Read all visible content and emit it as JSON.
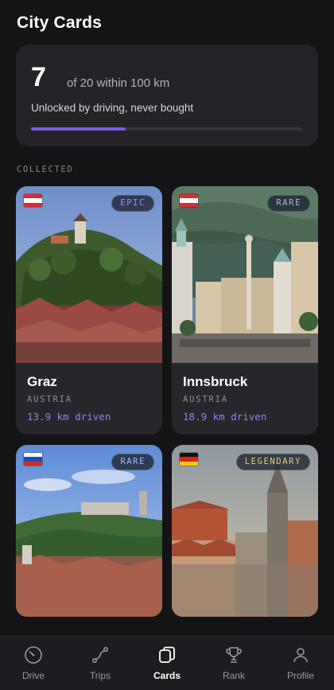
{
  "header": {
    "title": "City Cards"
  },
  "summary": {
    "count": "7",
    "of_text": "of 20 within 100 km",
    "description": "Unlocked by driving, never bought",
    "progress": 0.35
  },
  "section_label": "COLLECTED",
  "cards": [
    {
      "city": "Graz",
      "country": "AUSTRIA",
      "distance": "13.9 km driven",
      "rarity": "EPIC",
      "flag": [
        "#d92b35",
        "#ffffff",
        "#d92b35"
      ]
    },
    {
      "city": "Innsbruck",
      "country": "AUSTRIA",
      "distance": "18.9 km driven",
      "rarity": "RARE",
      "flag": [
        "#d92b35",
        "#ffffff",
        "#d92b35"
      ]
    },
    {
      "rarity": "RARE",
      "flag": [
        "#ffffff",
        "#1f4bb8",
        "#d52b1e"
      ]
    },
    {
      "rarity": "LEGENDARY",
      "flag": [
        "#111111",
        "#dd1f1f",
        "#ffcc00"
      ]
    }
  ],
  "tabbar": {
    "items": [
      {
        "label": "Drive",
        "icon": "speedometer-icon"
      },
      {
        "label": "Trips",
        "icon": "route-icon"
      },
      {
        "label": "Cards",
        "icon": "cards-icon",
        "active": true
      },
      {
        "label": "Rank",
        "icon": "trophy-icon"
      },
      {
        "label": "Profile",
        "icon": "person-icon"
      }
    ]
  },
  "colors": {
    "accent": "#7c5ce6",
    "background": "#141316",
    "surface": "#242327"
  }
}
